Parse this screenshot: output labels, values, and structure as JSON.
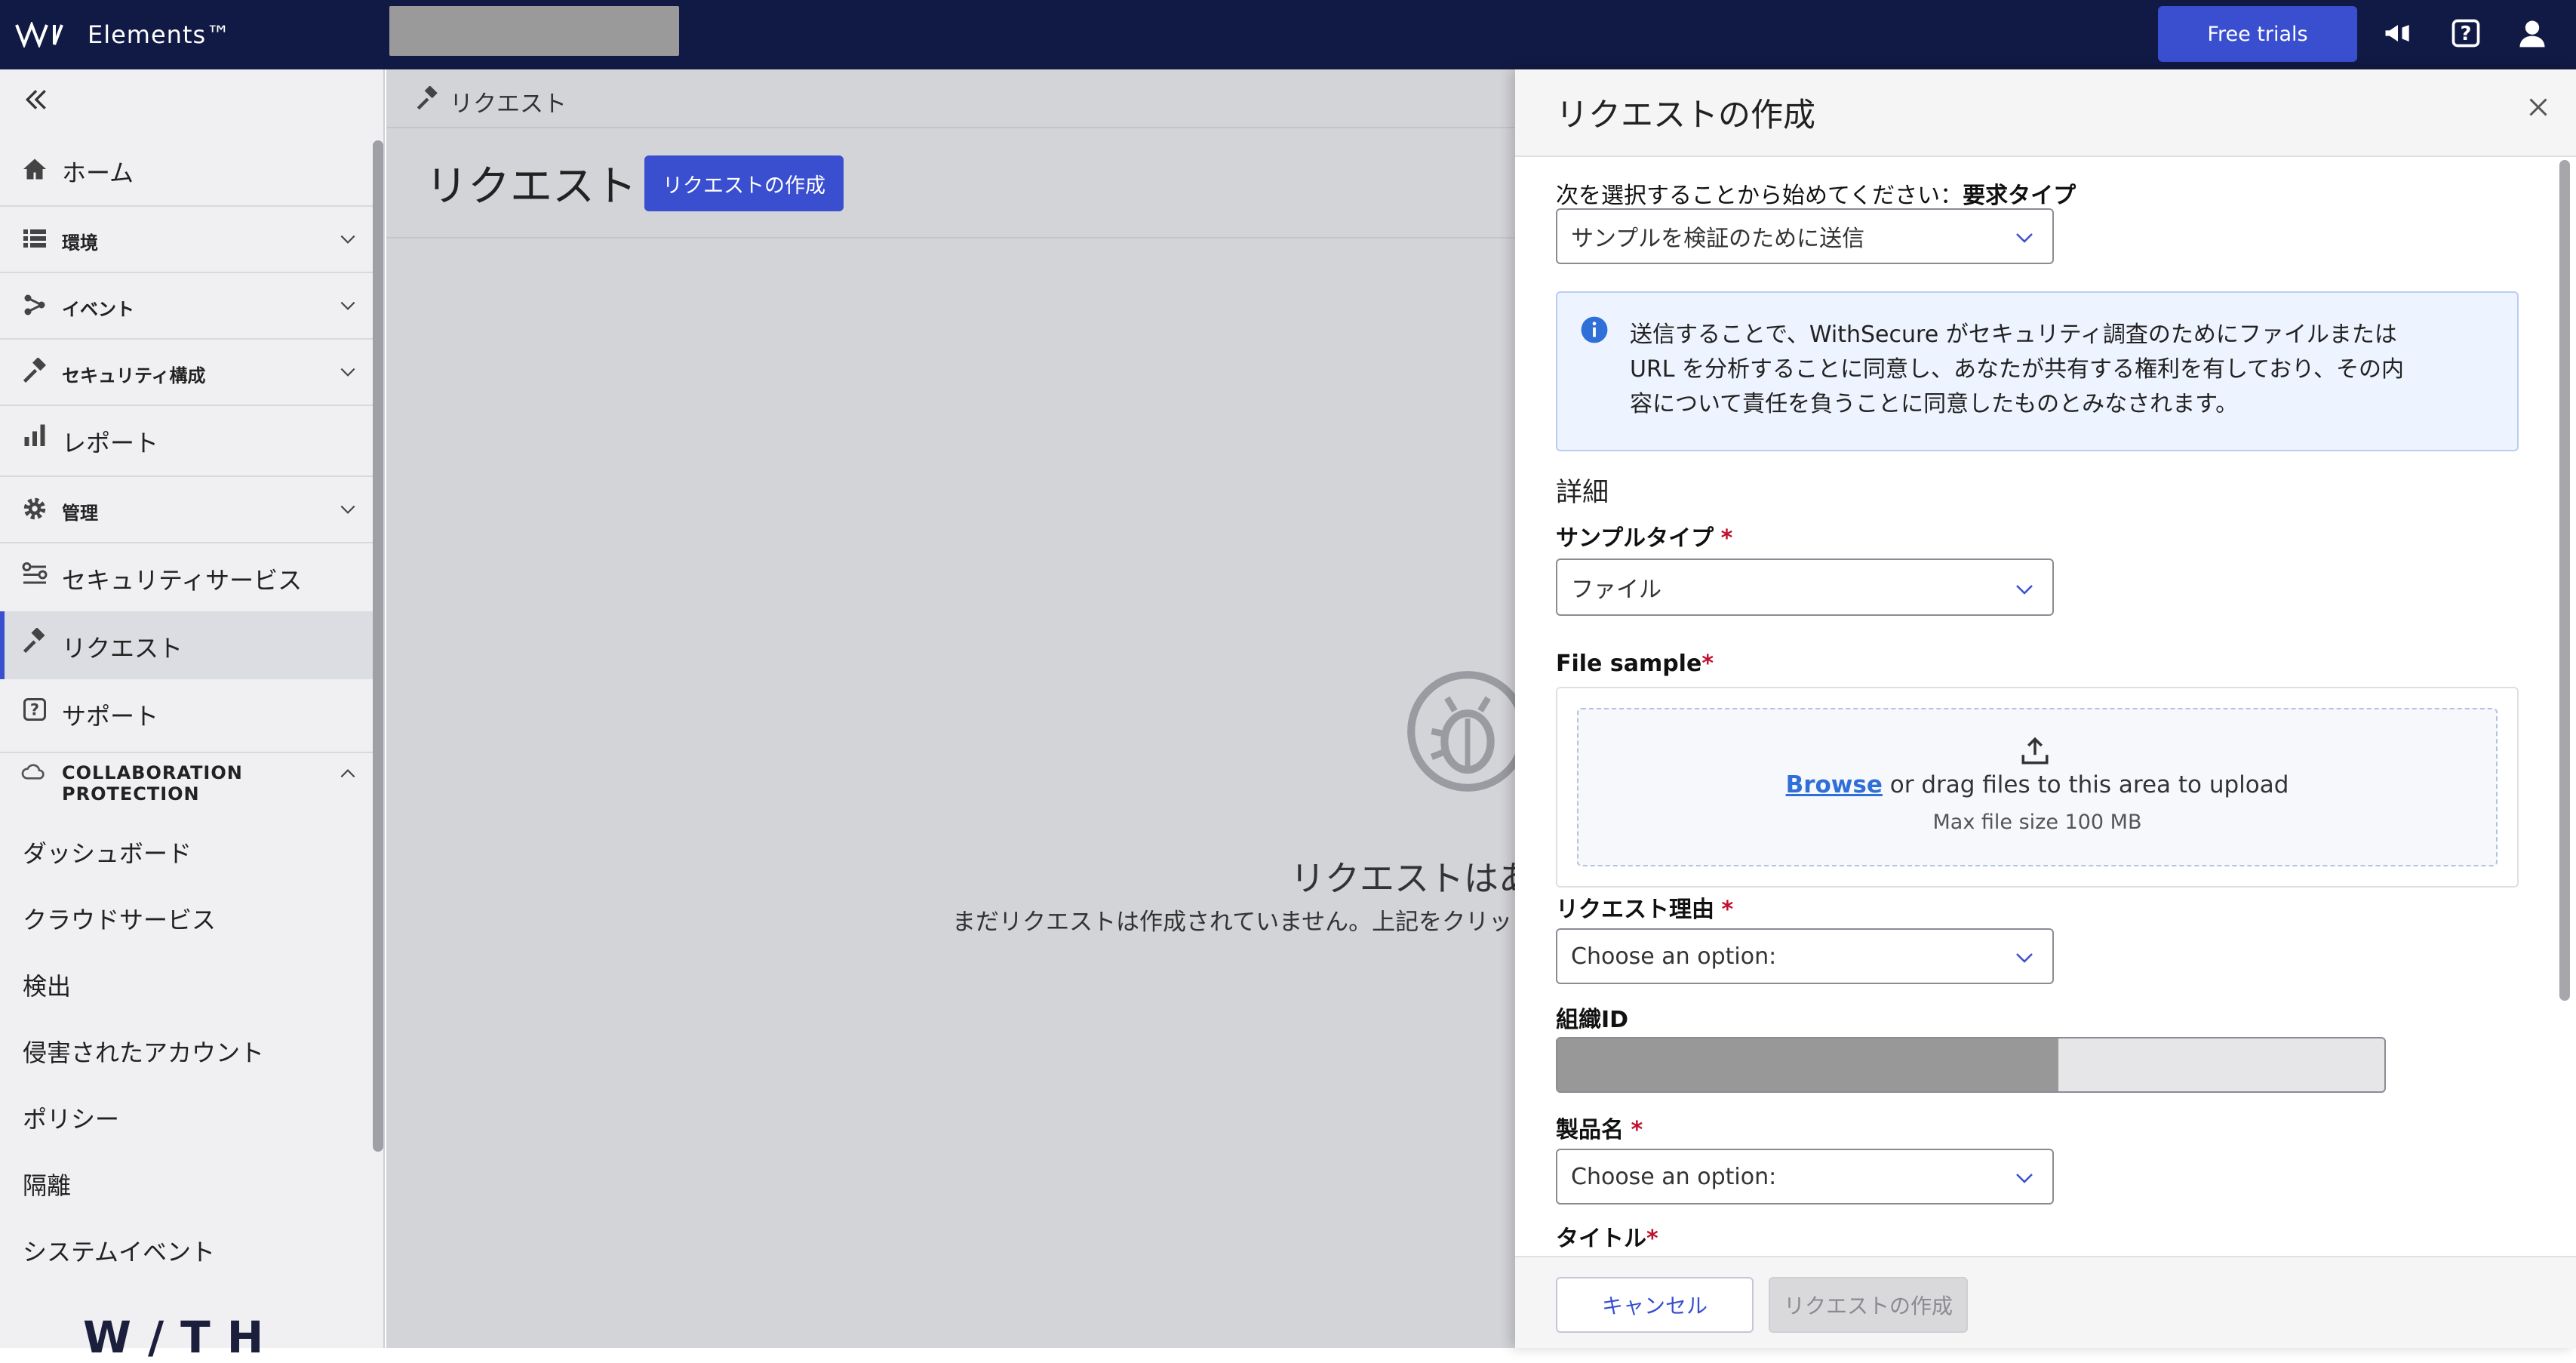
{
  "app": {
    "brand": "Elements™",
    "free_trials": "Free trials"
  },
  "sidebar": {
    "items": [
      {
        "label": "ホーム",
        "icon": "home-icon"
      },
      {
        "label": "環境",
        "icon": "list-icon"
      },
      {
        "label": "イベント",
        "icon": "events-icon"
      },
      {
        "label": "セキュリティ構成",
        "icon": "hammer-icon"
      },
      {
        "label": "レポート",
        "icon": "bar-chart-icon"
      },
      {
        "label": "管理",
        "icon": "gear-icon"
      },
      {
        "label": "セキュリティサービス",
        "icon": "security-services-icon"
      },
      {
        "label": "リクエスト",
        "icon": "gavel-icon"
      },
      {
        "label": "サポート",
        "icon": "help-icon"
      }
    ],
    "section": {
      "line1": "COLLABORATION",
      "line2": "PROTECTION"
    },
    "sub_items": [
      "ダッシュボード",
      "クラウドサービス",
      "検出",
      "侵害されたアカウント",
      "ポリシー",
      "隔離",
      "システムイベント"
    ],
    "footer_brand": "W/TH"
  },
  "main": {
    "breadcrumb": "リクエスト",
    "title": "リクエスト",
    "create_button": "リクエストの作成",
    "empty_title": "リクエストはあ",
    "empty_desc": "まだリクエストは作成されていません。上記をクリッ"
  },
  "drawer": {
    "title": "リクエストの作成",
    "prompt_prefix": "次を選択することから始めてください：",
    "prompt_bold": "要求タイプ",
    "request_type_value": "サンプルを検証のために送信",
    "info_lines": [
      "送信することで、WithSecure がセキュリティ調査のためにファイルまたは",
      "URL を分析することに同意し、あなたが共有する権利を有しており、その内",
      "容について責任を負うことに同意したものとみなされます。"
    ],
    "details_heading": "詳細",
    "sample_type_label": "サンプルタイプ",
    "sample_type_value": "ファイル",
    "file_sample_label": "File sample",
    "browse": "Browse",
    "drag_text": " or drag files to this area to upload",
    "max_size": "Max file size 100 MB",
    "reason_label": "リクエスト理由",
    "reason_value": "Choose an option:",
    "org_id_label": "組織ID",
    "product_label": "製品名",
    "product_value": "Choose an option:",
    "title_label": "タイトル",
    "required_mark": "*",
    "cancel": "キャンセル",
    "create": "リクエストの作成"
  },
  "colors": {
    "topbar": "#111a44",
    "accent": "#3a4fd0",
    "required": "#c0102c",
    "link": "#2f6fd8"
  }
}
